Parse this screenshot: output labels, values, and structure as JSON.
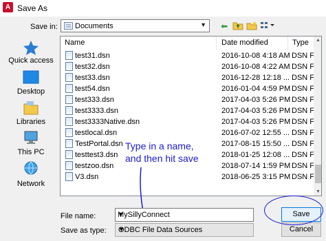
{
  "window": {
    "title": "Save As",
    "app_icon_text": "A"
  },
  "toolbar": {
    "save_in_label": "Save in:",
    "save_in_value": "Documents",
    "back_icon": "back-arrow-icon",
    "up_icon": "up-folder-icon",
    "new_folder_icon": "new-folder-icon",
    "views_icon": "views-menu-icon"
  },
  "places": [
    {
      "label": "Quick access",
      "icon": "star-icon"
    },
    {
      "label": "Desktop",
      "icon": "desktop-icon"
    },
    {
      "label": "Libraries",
      "icon": "libraries-icon"
    },
    {
      "label": "This PC",
      "icon": "computer-icon"
    },
    {
      "label": "Network",
      "icon": "network-icon"
    }
  ],
  "columns": {
    "name": "Name",
    "date": "Date modified",
    "type": "Type"
  },
  "files": [
    {
      "name": "test31.dsn",
      "date": "2016-10-08 4:18 AM",
      "type": "DSN Fi"
    },
    {
      "name": "test32.dsn",
      "date": "2016-10-08 4:22 AM",
      "type": "DSN Fi"
    },
    {
      "name": "test33.dsn",
      "date": "2016-12-28 12:18 ...",
      "type": "DSN Fi"
    },
    {
      "name": "test54.dsn",
      "date": "2016-01-04 4:59 PM",
      "type": "DSN Fi"
    },
    {
      "name": "test333.dsn",
      "date": "2017-04-03 5:26 PM",
      "type": "DSN Fi"
    },
    {
      "name": "test3333.dsn",
      "date": "2017-04-03 5:26 PM",
      "type": "DSN Fi"
    },
    {
      "name": "test3333Native.dsn",
      "date": "2017-04-03 5:26 PM",
      "type": "DSN Fi"
    },
    {
      "name": "testlocal.dsn",
      "date": "2016-07-02 12:55 ...",
      "type": "DSN Fi"
    },
    {
      "name": "TestPortal.dsn",
      "date": "2017-08-15 15:50 ...",
      "type": "DSN Fi"
    },
    {
      "name": "testtest3.dsn",
      "date": "2018-01-25 12:08 ...",
      "type": "DSN Fi"
    },
    {
      "name": "testzoo.dsn",
      "date": "2018-07-14 1:59 PM",
      "type": "DSN Fi"
    },
    {
      "name": "V3.dsn",
      "date": "2018-06-25 3:15 PM",
      "type": "DSN Fi"
    }
  ],
  "annotation": {
    "line1": "Type in a name,",
    "line2": "and then hit save",
    "color": "#1b1bd4"
  },
  "filename": {
    "label": "File name:",
    "value": "MySillyConnect"
  },
  "savetype": {
    "label": "Save as type:",
    "value": "ODBC File Data Sources"
  },
  "buttons": {
    "save": "Save",
    "cancel": "Cancel"
  }
}
